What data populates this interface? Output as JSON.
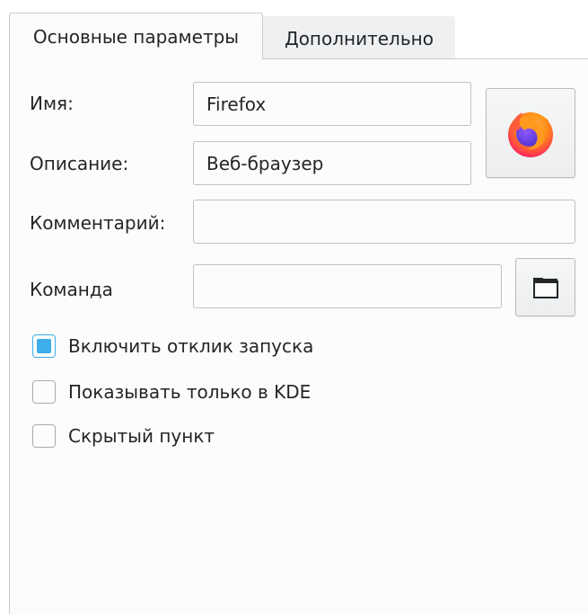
{
  "tabs": [
    {
      "label": "Основные параметры",
      "active": true
    },
    {
      "label": "Дополнительно",
      "active": false
    }
  ],
  "form": {
    "name_label": "Имя:",
    "name_value": "Firefox",
    "description_label": "Описание:",
    "description_value": "Веб-браузер",
    "comment_label": "Комментарий:",
    "comment_value": "",
    "command_label": "Команда",
    "command_value": ""
  },
  "app_icon": "firefox-icon",
  "browse_icon": "folder-icon",
  "checkboxes": [
    {
      "label": "Включить отклик запуска",
      "checked": true
    },
    {
      "label": "Показывать только в KDE",
      "checked": false
    },
    {
      "label": "Скрытый пункт",
      "checked": false
    }
  ],
  "colors": {
    "accent": "#3daee9",
    "firefox_orange": "#ff7139",
    "firefox_purple": "#7542e5"
  }
}
